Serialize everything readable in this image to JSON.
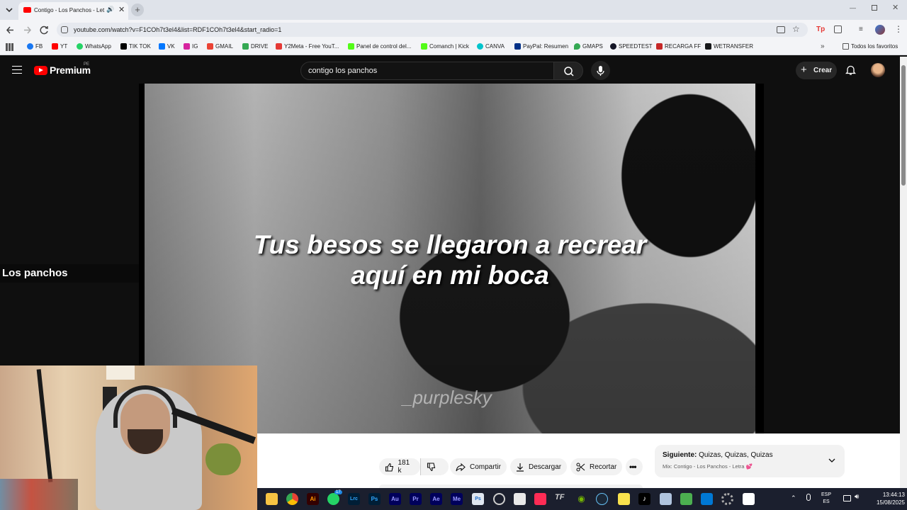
{
  "browser": {
    "tab_title": "Contigo - Los Panchos - Let",
    "url": "youtube.com/watch?v=F1COh7t3el4&list=RDF1COh7t3el4&start_radio=1",
    "bookmarks": [
      {
        "label": "FB",
        "icon": "facebook-icon",
        "color": "#1877f2"
      },
      {
        "label": "YT",
        "icon": "youtube-icon",
        "color": "#ff0000"
      },
      {
        "label": "WhatsApp",
        "icon": "whatsapp-icon",
        "color": "#25d366"
      },
      {
        "label": "TIK TOK",
        "icon": "tiktok-icon",
        "color": "#000000"
      },
      {
        "label": "VK",
        "icon": "vk-icon",
        "color": "#0077ff"
      },
      {
        "label": "IG",
        "icon": "instagram-icon",
        "color": "#d6249f"
      },
      {
        "label": "GMAIL",
        "icon": "gmail-icon",
        "color": "#ea4335"
      },
      {
        "label": "DRIVE",
        "icon": "drive-icon",
        "color": "#34a853"
      },
      {
        "label": "Y2Meta - Free YouT...",
        "icon": "y2meta-icon",
        "color": "#e53935"
      },
      {
        "label": "Panel de control del...",
        "icon": "kick-icon",
        "color": "#53fc18"
      },
      {
        "label": "Comanch | Kick",
        "icon": "kick-icon",
        "color": "#53fc18"
      },
      {
        "label": "CANVA",
        "icon": "canva-icon",
        "color": "#00c4cc"
      },
      {
        "label": "PayPal: Resumen",
        "icon": "paypal-icon",
        "color": "#003087"
      },
      {
        "label": "GMAPS",
        "icon": "maps-icon",
        "color": "#34a853"
      },
      {
        "label": "SPEEDTEST",
        "icon": "speedtest-icon",
        "color": "#141526"
      },
      {
        "label": "RECARGA FF",
        "icon": "recarga-icon",
        "color": "#c62828"
      },
      {
        "label": "WETRANSFER",
        "icon": "wetransfer-icon",
        "color": "#17181a"
      }
    ],
    "all_favorites": "Todos los favoritos"
  },
  "youtube": {
    "logo": "Premium",
    "region": "PE",
    "search_value": "contigo los panchos",
    "create_label": "Crear"
  },
  "player": {
    "lyrics_line1": "Tus besos se llegaron a recrear",
    "lyrics_line2": "aquí en mi boca",
    "watermark": "_purplesky",
    "chapter_title": "Los panchos"
  },
  "actions": {
    "likes": "181 k",
    "share": "Compartir",
    "download": "Descargar",
    "clip": "Recortar"
  },
  "next": {
    "label": "Siguiente:",
    "title": "Quizas, Quizas, Quizas",
    "mix": "Mix: Contigo - Los Panchos - Letra"
  },
  "taskbar": {
    "lang1": "ESP",
    "lang2": "ES",
    "time": "13:44:13",
    "date": "15/08/2025",
    "whatsapp_badge": "17"
  }
}
